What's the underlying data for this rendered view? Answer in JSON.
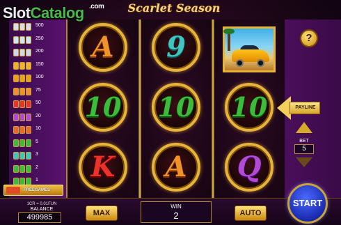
{
  "watermark": {
    "part1": "Slot",
    "part2": "Catalog",
    "suffix": ".com"
  },
  "game": {
    "title": "Scarlet Season"
  },
  "paytable": {
    "rows": [
      {
        "value": "500",
        "icon": "car-icon",
        "color": "#d9dde6"
      },
      {
        "value": "250",
        "icon": "yacht-icon",
        "color": "#cfe7f4"
      },
      {
        "value": "200",
        "icon": "plane-icon",
        "color": "#cfd8e6"
      },
      {
        "value": "150",
        "icon": "coins-icon",
        "color": "#f0b030"
      },
      {
        "value": "100",
        "icon": "gold-icon",
        "color": "#e9a21a"
      },
      {
        "value": "75",
        "icon": "a-letter-icon",
        "color": "#f0922a"
      },
      {
        "value": "50",
        "icon": "k-letter-icon",
        "color": "#e8322a"
      },
      {
        "value": "20",
        "icon": "q-letter-icon",
        "color": "#b24ad6"
      },
      {
        "value": "10",
        "icon": "j-letter-icon",
        "color": "#e86a2a"
      },
      {
        "value": "5",
        "icon": "ten-icon",
        "color": "#3bbd3b"
      },
      {
        "value": "3",
        "icon": "nine-icon",
        "color": "#3fc6c0"
      },
      {
        "value": "2",
        "icon": "cherry-icon",
        "color": "#3bbd3b"
      },
      {
        "value": "1",
        "icon": "seven-icon",
        "color": "#3bbd3b"
      }
    ],
    "freegames_label": "FREEGAMES"
  },
  "reels": [
    [
      {
        "type": "letter",
        "text": "A",
        "color": "orange"
      },
      {
        "type": "letter",
        "text": "10",
        "color": "green"
      },
      {
        "type": "letter",
        "text": "K",
        "color": "red"
      }
    ],
    [
      {
        "type": "letter",
        "text": "9",
        "color": "teal"
      },
      {
        "type": "letter",
        "text": "10",
        "color": "green"
      },
      {
        "type": "letter",
        "text": "A",
        "color": "orange"
      }
    ],
    [
      {
        "type": "car",
        "text": ""
      },
      {
        "type": "letter",
        "text": "10",
        "color": "green"
      },
      {
        "type": "letter",
        "text": "Q",
        "color": "purple"
      }
    ]
  ],
  "controls": {
    "help_label": "?",
    "payline_label": "PAYLINE",
    "bet_label": "BET",
    "bet_value": "5",
    "credit_rate": "1CR = 0.01FUN",
    "balance_label": "BALANCE",
    "balance_value": "499985",
    "max_label": "MAX",
    "win_label": "WIN",
    "win_value": "2",
    "auto_label": "AUTO",
    "start_label": "START"
  }
}
